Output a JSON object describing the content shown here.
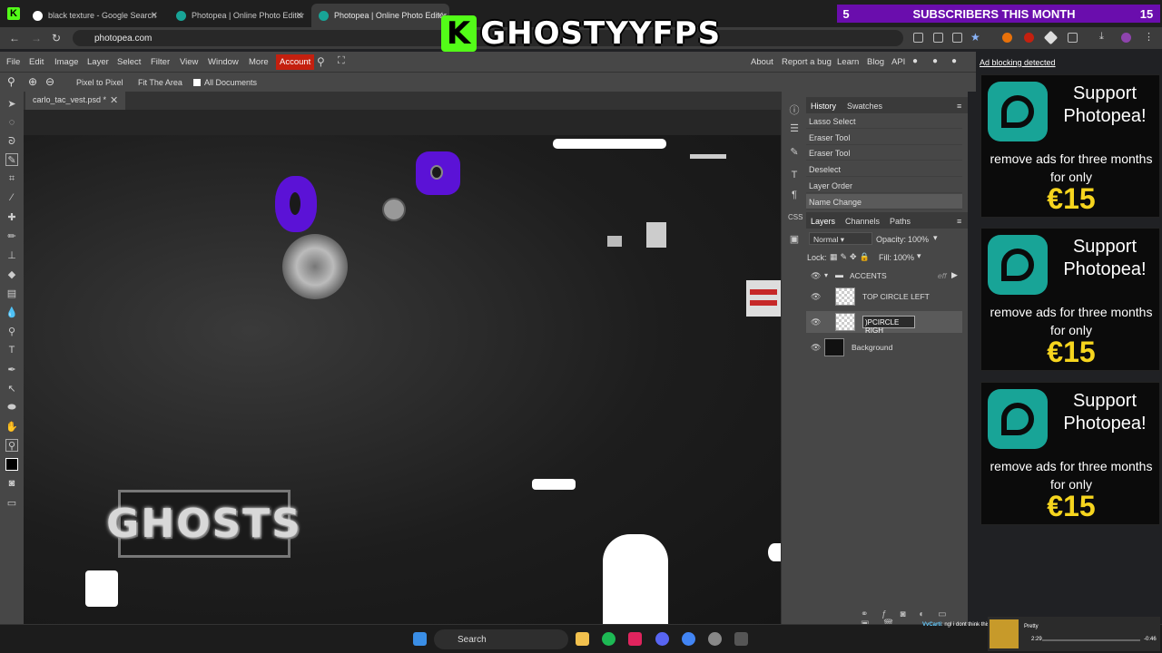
{
  "browser": {
    "tabs": [
      {
        "title": "black texture - Google Search"
      },
      {
        "title": "Photopea | Online Photo Editor"
      },
      {
        "title": "Photopea | Online Photo Editor"
      }
    ],
    "url": "photopea.com"
  },
  "overlay": {
    "sub_count_left": "5",
    "sub_label": "SUBSCRIBERS THIS MONTH",
    "sub_count_right": "15",
    "logo_text": "GHOSTYYFPS",
    "logo_badge": "K"
  },
  "menu": {
    "items": [
      "File",
      "Edit",
      "Image",
      "Layer",
      "Select",
      "Filter",
      "View",
      "Window",
      "More"
    ],
    "account": "Account",
    "right_links": [
      "About",
      "Report a bug",
      "Learn",
      "Blog",
      "API"
    ]
  },
  "options": {
    "pixel_to_pixel": "Pixel to Pixel",
    "fit_area": "Fit The Area",
    "all_documents": "All Documents"
  },
  "ad_label": "Ad blocking detected",
  "document": {
    "tab_title": "carlo_tac_vest.psd *"
  },
  "canvas": {
    "plate_text": "GHOSTS"
  },
  "history": {
    "tabs": [
      "History",
      "Swatches"
    ],
    "items": [
      "Lasso Select",
      "Eraser Tool",
      "Eraser Tool",
      "Deselect",
      "Layer Order",
      "Name Change"
    ]
  },
  "layers": {
    "tabs": [
      "Layers",
      "Channels",
      "Paths"
    ],
    "blend_mode": "Normal",
    "opacity_label": "Opacity:",
    "opacity": "100%",
    "lock_label": "Lock:",
    "fill_label": "Fill:",
    "fill": "100%",
    "group_name": "ACCENTS",
    "group_fx": "eff",
    "layer1": "TOP CIRCLE LEFT",
    "layer2_editing": ")PCIRCLE RIGH",
    "background": "Background"
  },
  "ads": [
    {
      "headline": "Support Photopea!",
      "sub": "remove ads for three months for only",
      "price": "€15"
    },
    {
      "headline": "Support Photopea!",
      "sub": "remove ads for three months for only",
      "price": "€15"
    },
    {
      "headline": "Support Photopea!",
      "sub": "remove ads for three months for only",
      "price": "€15"
    }
  ],
  "taskbar": {
    "search": "Search"
  },
  "spotify": {
    "track": "Pretty",
    "time_elapsed": "2:29",
    "time_remaining": "-0:46"
  },
  "chat": {
    "user": "VvCarti",
    "message": ": ngl i dont think this clothing slot for me"
  },
  "colors": {
    "accent": "#c4200f",
    "ad_price": "#f6d51e",
    "ad_logo": "#18a497",
    "sub_banner": "#6a0dad",
    "kick_green": "#53fc18"
  }
}
